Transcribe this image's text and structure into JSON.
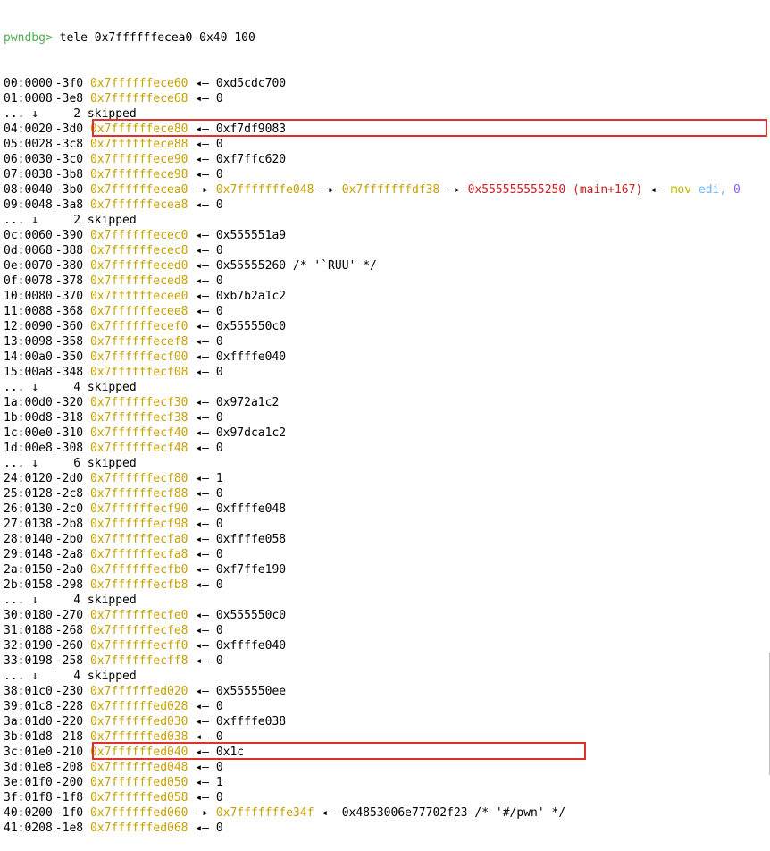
{
  "prompt": "pwndbg>",
  "command": " tele 0x7ffffffecea0-0x40 100",
  "arrow": "—▸",
  "leftArrow": "◂—",
  "rows": [
    {
      "idx": "00:0000",
      "off": "-3f0",
      "addr": "0x7ffffffece60",
      "val": "0xd5cdc700"
    },
    {
      "idx": "01:0008",
      "off": "-3e8",
      "addr": "0x7ffffffece68",
      "val": "0"
    },
    {
      "skip": "... ↓     2 skipped"
    },
    {
      "idx": "04:0020",
      "off": "-3d0",
      "addr": "0x7ffffffece80",
      "val": "0xf7df9083"
    },
    {
      "idx": "05:0028",
      "off": "-3c8",
      "addr": "0x7ffffffece88",
      "val": "0"
    },
    {
      "idx": "06:0030",
      "off": "-3c0",
      "addr": "0x7ffffffece90",
      "val": "0xf7ffc620"
    },
    {
      "idx": "07:0038",
      "off": "-3b8",
      "addr": "0x7ffffffece98",
      "val": "0"
    },
    {
      "idx": "08:0040",
      "off": "-3b0",
      "addr": "0x7ffffffecea0",
      "chain": [
        "0x7fffffffe048",
        "0x7fffffffdf38"
      ],
      "final": "0x555555555250 (main+167)",
      "instr": "mov",
      "reg": "edi,",
      "imm": "0"
    },
    {
      "idx": "09:0048",
      "off": "-3a8",
      "addr": "0x7ffffffecea8",
      "val": "0"
    },
    {
      "skip": "... ↓     2 skipped"
    },
    {
      "idx": "0c:0060",
      "off": "-390",
      "addr": "0x7ffffffecec0",
      "val": "0x555551a9"
    },
    {
      "idx": "0d:0068",
      "off": "-388",
      "addr": "0x7ffffffecec8",
      "val": "0"
    },
    {
      "idx": "0e:0070",
      "off": "-380",
      "addr": "0x7ffffffeced0",
      "val": "0x55555260 /* '`RUU' */"
    },
    {
      "idx": "0f:0078",
      "off": "-378",
      "addr": "0x7ffffffeced8",
      "val": "0"
    },
    {
      "idx": "10:0080",
      "off": "-370",
      "addr": "0x7ffffffecee0",
      "val": "0xb7b2a1c2"
    },
    {
      "idx": "11:0088",
      "off": "-368",
      "addr": "0x7ffffffecee8",
      "val": "0"
    },
    {
      "idx": "12:0090",
      "off": "-360",
      "addr": "0x7ffffffecef0",
      "val": "0x555550c0"
    },
    {
      "idx": "13:0098",
      "off": "-358",
      "addr": "0x7ffffffecef8",
      "val": "0"
    },
    {
      "idx": "14:00a0",
      "off": "-350",
      "addr": "0x7ffffffecf00",
      "val": "0xffffe040"
    },
    {
      "idx": "15:00a8",
      "off": "-348",
      "addr": "0x7ffffffecf08",
      "val": "0"
    },
    {
      "skip": "... ↓     4 skipped"
    },
    {
      "idx": "1a:00d0",
      "off": "-320",
      "addr": "0x7ffffffecf30",
      "val": "0x972a1c2"
    },
    {
      "idx": "1b:00d8",
      "off": "-318",
      "addr": "0x7ffffffecf38",
      "val": "0"
    },
    {
      "idx": "1c:00e0",
      "off": "-310",
      "addr": "0x7ffffffecf40",
      "val": "0x97dca1c2"
    },
    {
      "idx": "1d:00e8",
      "off": "-308",
      "addr": "0x7ffffffecf48",
      "val": "0"
    },
    {
      "skip": "... ↓     6 skipped"
    },
    {
      "idx": "24:0120",
      "off": "-2d0",
      "addr": "0x7ffffffecf80",
      "val": "1"
    },
    {
      "idx": "25:0128",
      "off": "-2c8",
      "addr": "0x7ffffffecf88",
      "val": "0"
    },
    {
      "idx": "26:0130",
      "off": "-2c0",
      "addr": "0x7ffffffecf90",
      "val": "0xffffe048"
    },
    {
      "idx": "27:0138",
      "off": "-2b8",
      "addr": "0x7ffffffecf98",
      "val": "0"
    },
    {
      "idx": "28:0140",
      "off": "-2b0",
      "addr": "0x7ffffffecfa0",
      "val": "0xffffe058"
    },
    {
      "idx": "29:0148",
      "off": "-2a8",
      "addr": "0x7ffffffecfa8",
      "val": "0"
    },
    {
      "idx": "2a:0150",
      "off": "-2a0",
      "addr": "0x7ffffffecfb0",
      "val": "0xf7ffe190"
    },
    {
      "idx": "2b:0158",
      "off": "-298",
      "addr": "0x7ffffffecfb8",
      "val": "0"
    },
    {
      "skip": "... ↓     4 skipped"
    },
    {
      "idx": "30:0180",
      "off": "-270",
      "addr": "0x7ffffffecfe0",
      "val": "0x555550c0"
    },
    {
      "idx": "31:0188",
      "off": "-268",
      "addr": "0x7ffffffecfe8",
      "val": "0"
    },
    {
      "idx": "32:0190",
      "off": "-260",
      "addr": "0x7ffffffecff0",
      "val": "0xffffe040"
    },
    {
      "idx": "33:0198",
      "off": "-258",
      "addr": "0x7ffffffecff8",
      "val": "0"
    },
    {
      "skip": "... ↓     4 skipped"
    },
    {
      "idx": "38:01c0",
      "off": "-230",
      "addr": "0x7ffffffed020",
      "val": "0x555550ee"
    },
    {
      "idx": "39:01c8",
      "off": "-228",
      "addr": "0x7ffffffed028",
      "val": "0"
    },
    {
      "idx": "3a:01d0",
      "off": "-220",
      "addr": "0x7ffffffed030",
      "val": "0xffffe038"
    },
    {
      "idx": "3b:01d8",
      "off": "-218",
      "addr": "0x7ffffffed038",
      "val": "0"
    },
    {
      "idx": "3c:01e0",
      "off": "-210",
      "addr": "0x7ffffffed040",
      "val": "0x1c"
    },
    {
      "idx": "3d:01e8",
      "off": "-208",
      "addr": "0x7ffffffed048",
      "val": "0"
    },
    {
      "idx": "3e:01f0",
      "off": "-200",
      "addr": "0x7ffffffed050",
      "val": "1"
    },
    {
      "idx": "3f:01f8",
      "off": "-1f8",
      "addr": "0x7ffffffed058",
      "val": "0"
    },
    {
      "idx": "40:0200",
      "off": "-1f0",
      "addr": "0x7ffffffed060",
      "chain": [
        "0x7fffffffe34f"
      ],
      "val2": "0x4853006e77702f23 /* '#/pwn' */"
    },
    {
      "idx": "41:0208",
      "off": "-1e8",
      "addr": "0x7ffffffed068",
      "val": "0"
    }
  ],
  "colors": {
    "prompt": "#4caf50",
    "address": "#c8a000",
    "code_pointer": "#cc2222",
    "highlight_box": "#e03030",
    "mnemonic": "#b7b700",
    "register": "#6fb5ff",
    "immediate": "#8b60ff"
  }
}
